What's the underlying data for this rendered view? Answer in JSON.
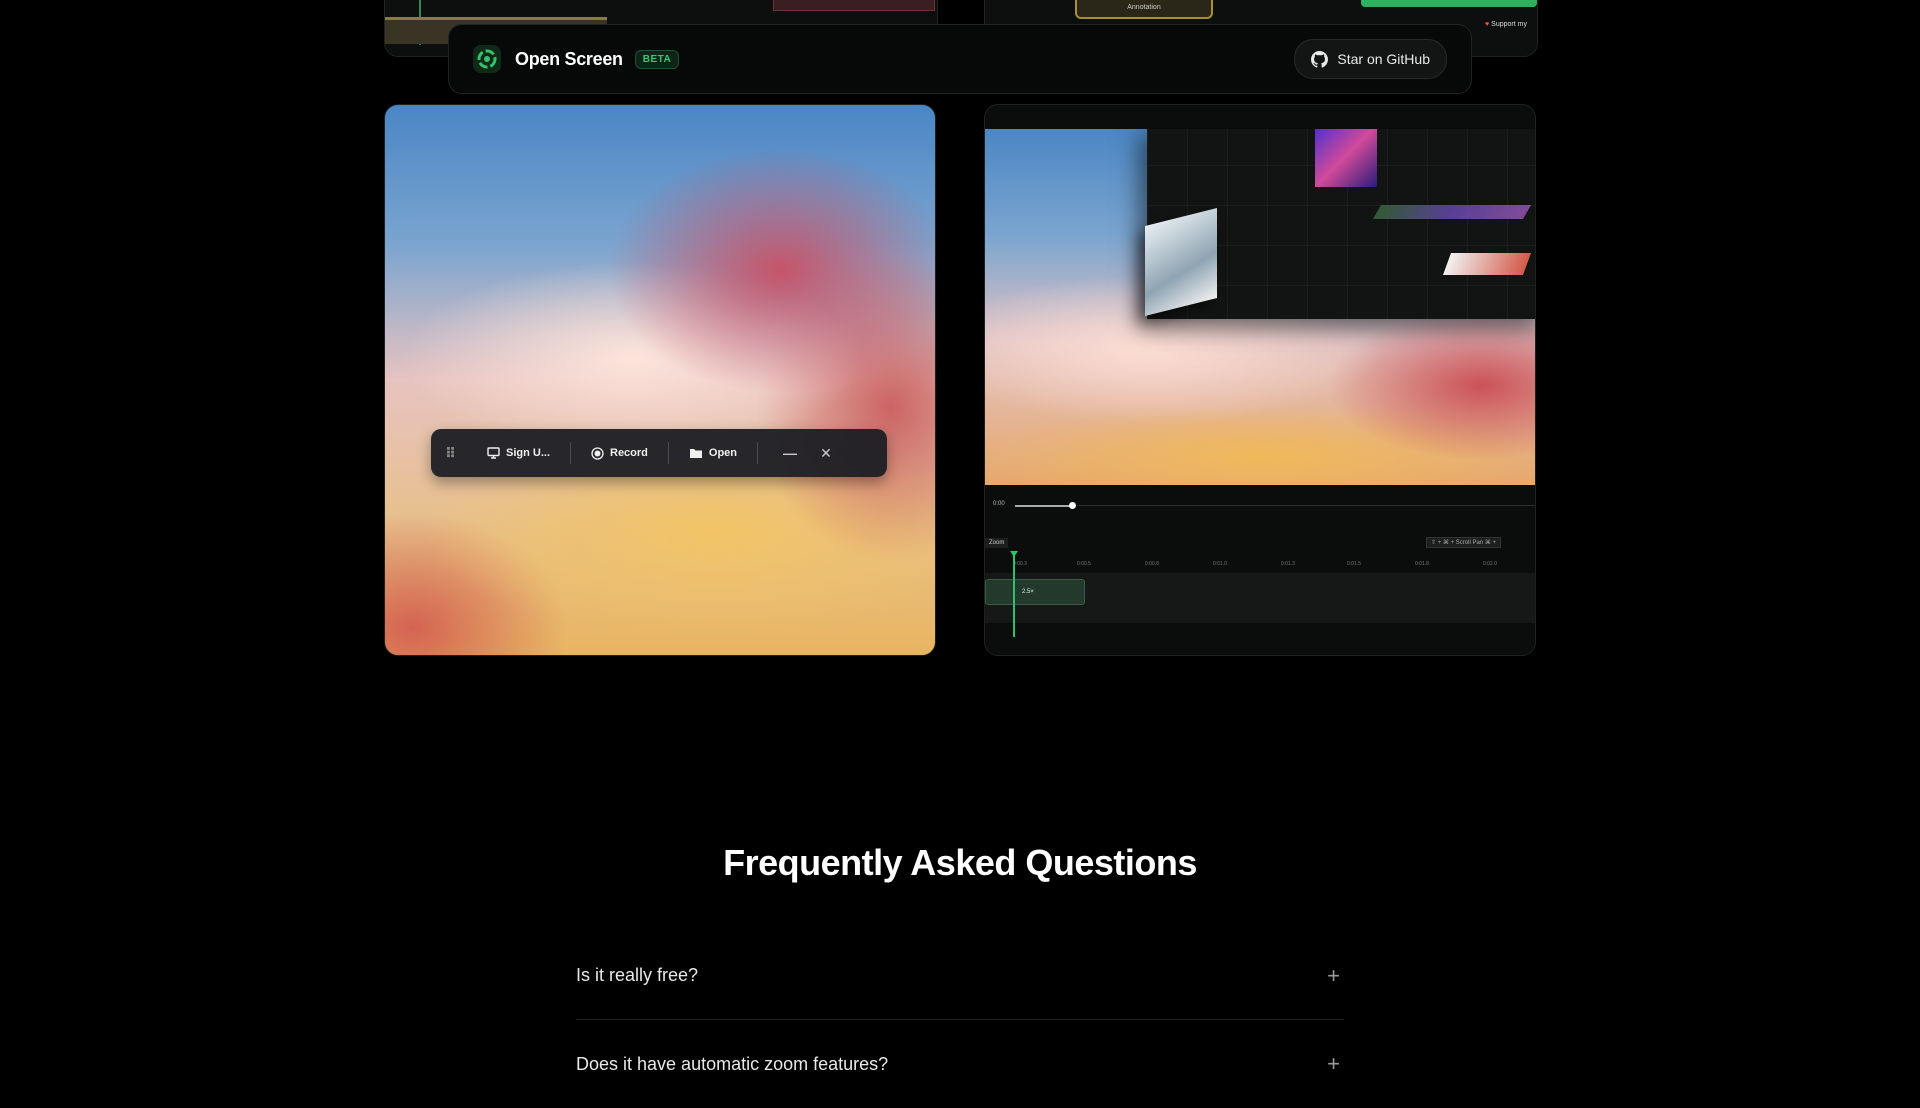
{
  "navbar": {
    "brand": "Open Screen",
    "badge": "BETA",
    "github_label": "Star on GitHub"
  },
  "prev_panel": {
    "annotation_label": "Annotation",
    "support_label": "Support my"
  },
  "hud": {
    "source_label": "Sign U...",
    "record_label": "Record",
    "open_label": "Open"
  },
  "editor": {
    "time": "0:00",
    "zoom_label": "Zoom",
    "shortcut": "⇧ + ⌘ + Scroll",
    "pan": "Pan",
    "cmd": "⌘ +",
    "clip_label": "2.5×",
    "ticks": [
      "0:00.3",
      "0:00.5",
      "0:00.8",
      "0:01.0",
      "0:01.3",
      "0:01.5",
      "0:01.8",
      "0:02.0"
    ]
  },
  "faq": {
    "title": "Frequently Asked Questions",
    "items": [
      {
        "question": "Is it really free?"
      },
      {
        "question": "Does it have automatic zoom features?"
      }
    ]
  },
  "colors": {
    "background": "#000000",
    "accent": "#37c873",
    "playhead": "#2ec06a"
  },
  "icons": {
    "logo": "open-screen-logo-icon",
    "github": "github-icon",
    "monitor": "monitor-icon",
    "record": "record-icon",
    "folder": "folder-icon",
    "minimize": "minimize-icon",
    "close": "close-icon",
    "plus": "plus-icon"
  }
}
